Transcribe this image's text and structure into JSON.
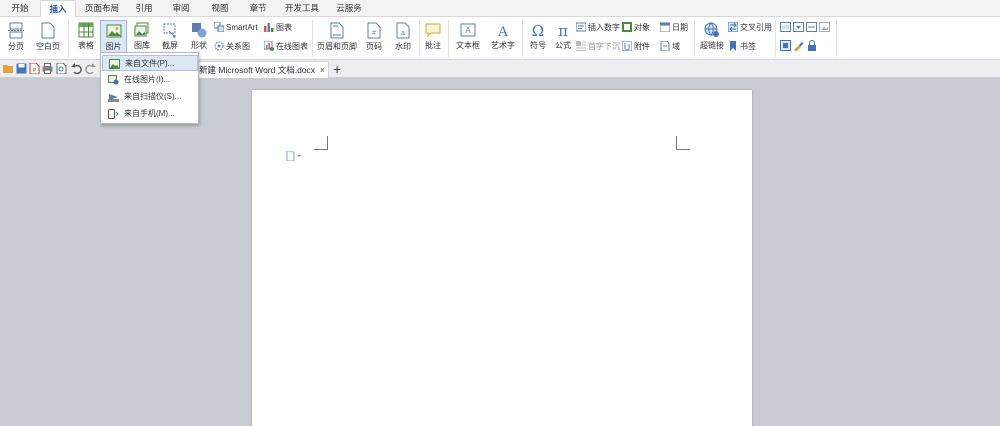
{
  "menu_tabs": [
    "开始",
    "插入",
    "页面布局",
    "引用",
    "审阅",
    "视图",
    "章节",
    "开发工具",
    "云服务"
  ],
  "active_tab": "插入",
  "ribbon": {
    "page_break": "分页",
    "blank_page": "空白页",
    "table": "表格",
    "picture": "图片",
    "gallery": "图库",
    "screenshot": "截屏",
    "shapes": "形状",
    "smartart": "SmartArt",
    "chart": "图表",
    "relation_chart": "关系图",
    "online_chart": "在线图表",
    "header_footer": "页眉和页脚",
    "page_number": "页码",
    "watermark": "水印",
    "comment": "批注",
    "textbox": "文本框",
    "wordart": "艺术字",
    "symbol": "符号",
    "formula": "公式",
    "insert_number": "插入数字",
    "drop_cap": "首字下沉",
    "object": "对象",
    "attachment": "附件",
    "date": "日期",
    "field": "域",
    "hyperlink": "超链接",
    "cross_ref": "交叉引用",
    "bookmark": "书签"
  },
  "document_tab": {
    "title": "新建 Microsoft Word 文档.docx",
    "close": "×",
    "add": "+"
  },
  "picture_menu": [
    "来自文件(P)...",
    "在线图片(I)...",
    "来自扫描仪(S)...",
    "来自手机(M)..."
  ],
  "colors": {
    "accent": "#2b579a",
    "highlight": "#dce8f6",
    "workspace": "#c9cdd3"
  }
}
